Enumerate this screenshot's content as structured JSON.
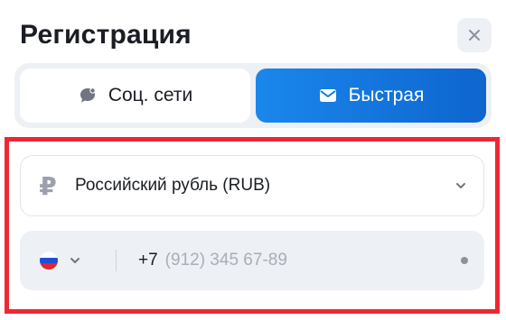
{
  "dialog": {
    "title": "Регистрация",
    "close_icon": "close-icon"
  },
  "tabs": [
    {
      "label": "Соц. сети",
      "icon": "chat-bubble-icon",
      "active": false
    },
    {
      "label": "Быстрая",
      "icon": "envelope-icon",
      "active": true
    }
  ],
  "currency": {
    "icon": "ruble-icon",
    "symbol": "₽",
    "selected": "Российский рубль (RUB)"
  },
  "phone": {
    "country_flag": "russia-flag-icon",
    "code": "+7",
    "value": "",
    "placeholder": "(912) 345 67-89"
  },
  "colors": {
    "accent": "#1a87ec",
    "highlight_border": "#ee2833",
    "field_background": "#edf0f5"
  }
}
